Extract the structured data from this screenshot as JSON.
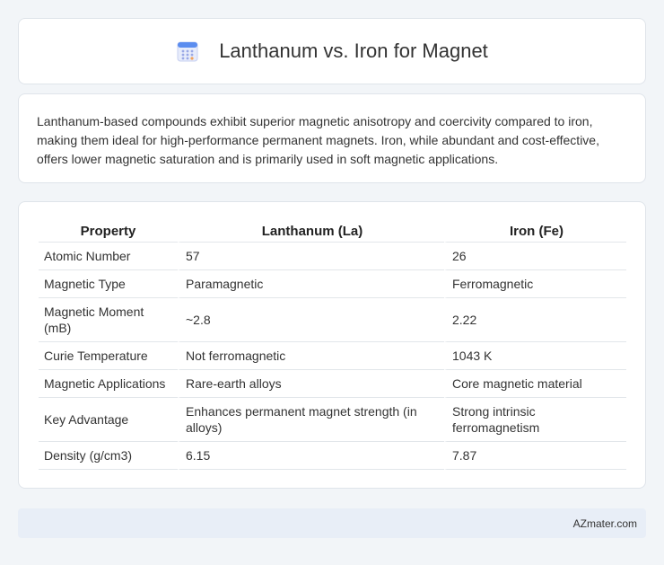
{
  "header": {
    "title": "Lanthanum vs. Iron for Magnet",
    "icon": "calendar-grid-icon"
  },
  "intro": {
    "text": "Lanthanum-based compounds exhibit superior magnetic anisotropy and coercivity compared to iron, making them ideal for high-performance permanent magnets. Iron, while abundant and cost-effective, offers lower magnetic saturation and is primarily used in soft magnetic applications."
  },
  "table": {
    "headers": [
      "Property",
      "Lanthanum (La)",
      "Iron (Fe)"
    ],
    "rows": [
      [
        "Atomic Number",
        "57",
        "26"
      ],
      [
        "Magnetic Type",
        "Paramagnetic",
        "Ferromagnetic"
      ],
      [
        "Magnetic Moment (mB)",
        "~2.8",
        "2.22"
      ],
      [
        "Curie Temperature",
        "Not ferromagnetic",
        "1043 K"
      ],
      [
        "Magnetic Applications",
        "Rare-earth alloys",
        "Core magnetic material"
      ],
      [
        "Key Advantage",
        "Enhances permanent magnet strength (in alloys)",
        "Strong intrinsic ferromagnetism"
      ],
      [
        "Density (g/cm3)",
        "6.15",
        "7.87"
      ]
    ]
  },
  "footer": {
    "brand": "AZmater.com"
  }
}
